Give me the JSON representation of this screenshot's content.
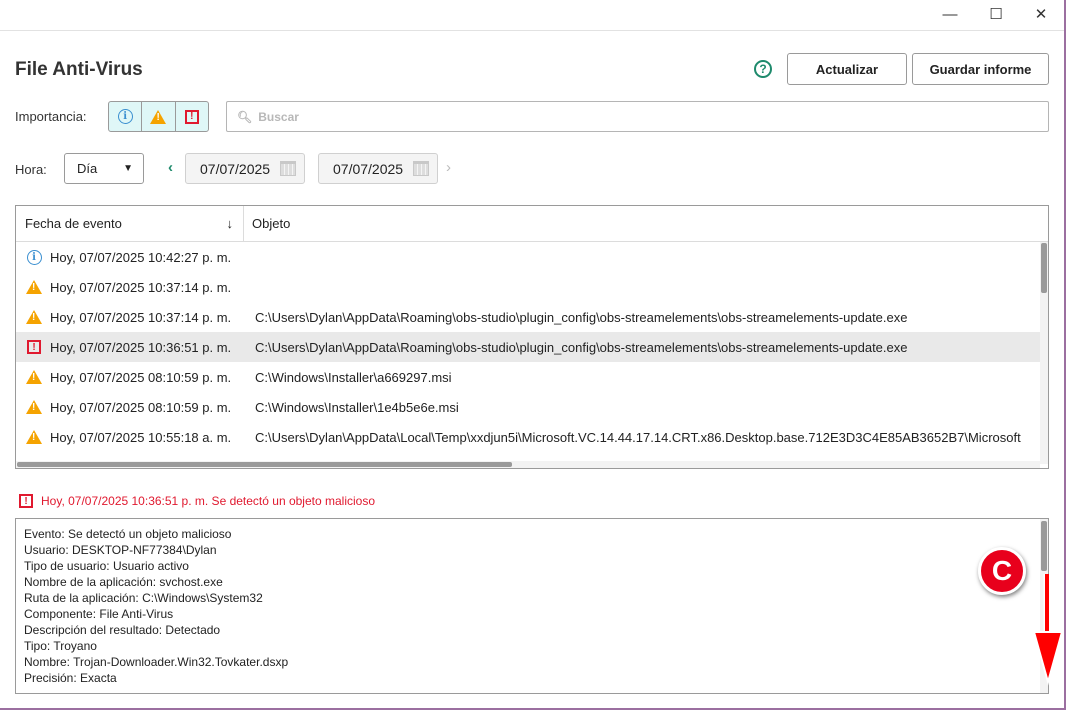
{
  "window": {
    "minimize": "—",
    "maximize": "☐",
    "close": "✕"
  },
  "header": {
    "title": "File Anti-Virus",
    "help": "?",
    "refresh_label": "Actualizar",
    "save_report_label": "Guardar informe"
  },
  "filters": {
    "importance_label": "Importancia:",
    "search_placeholder": "Buscar",
    "time_label": "Hora:",
    "period_value": "Día",
    "date_from": "07/07/2025",
    "date_to": "07/07/2025"
  },
  "table": {
    "columns": [
      "Fecha de evento",
      "Objeto"
    ],
    "sort_indicator": "↓",
    "rows": [
      {
        "severity": "info",
        "date": "Hoy, 07/07/2025 10:42:27 p. m.",
        "object": ""
      },
      {
        "severity": "warning",
        "date": "Hoy, 07/07/2025 10:37:14 p. m.",
        "object": ""
      },
      {
        "severity": "warning",
        "date": "Hoy, 07/07/2025 10:37:14 p. m.",
        "object": "C:\\Users\\Dylan\\AppData\\Roaming\\obs-studio\\plugin_config\\obs-streamelements\\obs-streamelements-update.exe"
      },
      {
        "severity": "error",
        "date": "Hoy, 07/07/2025 10:36:51 p. m.",
        "object": "C:\\Users\\Dylan\\AppData\\Roaming\\obs-studio\\plugin_config\\obs-streamelements\\obs-streamelements-update.exe",
        "selected": true
      },
      {
        "severity": "warning",
        "date": "Hoy, 07/07/2025 08:10:59 p. m.",
        "object": "C:\\Windows\\Installer\\a669297.msi"
      },
      {
        "severity": "warning",
        "date": "Hoy, 07/07/2025 08:10:59 p. m.",
        "object": "C:\\Windows\\Installer\\1e4b5e6e.msi"
      },
      {
        "severity": "warning",
        "date": "Hoy, 07/07/2025 10:55:18 a. m.",
        "object": "C:\\Users\\Dylan\\AppData\\Local\\Temp\\xxdjun5i\\Microsoft.VC.14.44.17.14.CRT.x86.Desktop.base.712E3D3C4E85AB3652B7\\Microsoft"
      }
    ]
  },
  "selected_event": {
    "summary": "Hoy, 07/07/2025 10:36:51 p. m. Se detectó un objeto malicioso",
    "details": [
      "Evento: Se detectó un objeto malicioso",
      "Usuario: DESKTOP-NF77384\\Dylan",
      "Tipo de usuario: Usuario activo",
      "Nombre de la aplicación: svchost.exe",
      "Ruta de la aplicación: C:\\Windows\\System32",
      "Componente: File Anti-Virus",
      "Descripción del resultado: Detectado",
      "Tipo: Troyano",
      "Nombre: Trojan-Downloader.Win32.Tovkater.dsxp",
      "Precisión: Exacta"
    ]
  },
  "annotation": {
    "label": "C",
    "color": "#e8001c"
  }
}
